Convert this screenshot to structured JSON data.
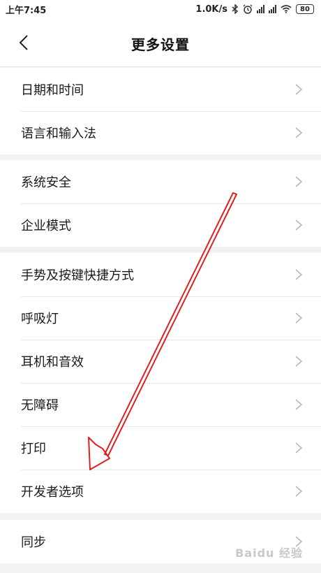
{
  "status_bar": {
    "time": "上午7:45",
    "network_speed": "1.0K/s",
    "battery": "80",
    "icons": [
      "bluetooth-icon",
      "alarm-icon",
      "signal-icon",
      "signal-icon",
      "wifi-icon",
      "battery-icon"
    ]
  },
  "header": {
    "back_icon": "chevron-left-icon",
    "title": "更多设置"
  },
  "groups": [
    {
      "items": [
        "日期和时间",
        "语言和输入法"
      ]
    },
    {
      "items": [
        "系统安全",
        "企业模式"
      ]
    },
    {
      "items": [
        "手势及按键快捷方式",
        "呼吸灯",
        "耳机和音效",
        "无障碍",
        "打印",
        "开发者选项"
      ]
    },
    {
      "items": [
        "同步"
      ]
    }
  ],
  "annotation": {
    "arrow_color": "#e02020",
    "target": "开发者选项"
  },
  "watermark": "Baidu 经验"
}
